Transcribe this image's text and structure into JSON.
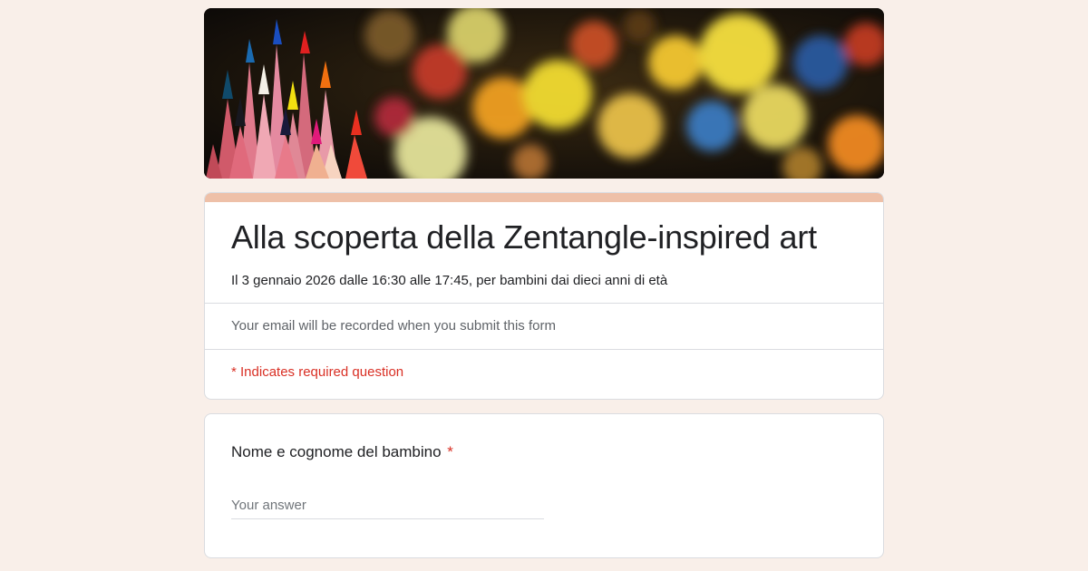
{
  "banner": {
    "image_name": "colored-pencils-bokeh-banner"
  },
  "form": {
    "title": "Alla scoperta della Zentangle-inspired art",
    "description": "Il 3 gennaio 2026 dalle 16:30 alle 17:45, per bambini dai dieci anni di età",
    "email_note": "Your email will be recorded when you submit this form",
    "required_note": "* Indicates required question"
  },
  "questions": [
    {
      "label": "Nome e cognome del bambino",
      "required_marker": "*",
      "placeholder": "Your answer"
    }
  ],
  "colors": {
    "background": "#f9efe9",
    "accent": "#eec0a8",
    "required": "#d93025"
  }
}
